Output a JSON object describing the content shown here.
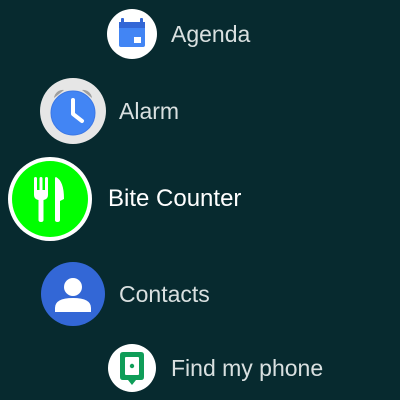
{
  "apps": [
    {
      "label": "Agenda",
      "icon": "calendar-icon",
      "icon_color": "#4285f4"
    },
    {
      "label": "Alarm",
      "icon": "alarm-clock-icon",
      "icon_color": "#4285f4"
    },
    {
      "label": "Bite Counter",
      "icon": "fork-knife-icon",
      "icon_color": "#00ff00",
      "selected": true
    },
    {
      "label": "Contacts",
      "icon": "person-icon",
      "icon_color": "#3367d6"
    },
    {
      "label": "Find my phone",
      "icon": "phone-location-icon",
      "icon_color": "#0f9d58"
    }
  ],
  "colors": {
    "background": "#072a2f",
    "label_text": "#d9e0e0",
    "selected_label_text": "#ffffff"
  }
}
